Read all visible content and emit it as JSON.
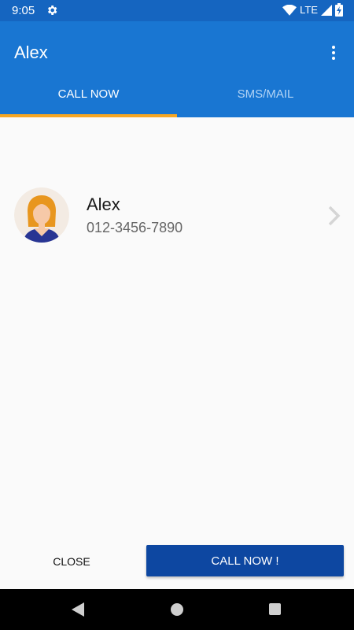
{
  "status_bar": {
    "time": "9:05",
    "network": "LTE",
    "icons": [
      "gear-icon",
      "wifi-icon",
      "signal-icon",
      "battery-charging-icon"
    ]
  },
  "app_bar": {
    "title": "Alex",
    "tabs": [
      {
        "label": "CALL NOW",
        "active": true
      },
      {
        "label": "SMS/MAIL",
        "active": false
      }
    ]
  },
  "contact": {
    "name": "Alex",
    "phone": "012-3456-7890"
  },
  "actions": {
    "close_label": "CLOSE",
    "call_label": "CALL NOW !"
  },
  "colors": {
    "status_bar": "#1565c0",
    "app_bar": "#1976d2",
    "tab_indicator": "#f5a623",
    "call_button": "#0d47a1"
  }
}
